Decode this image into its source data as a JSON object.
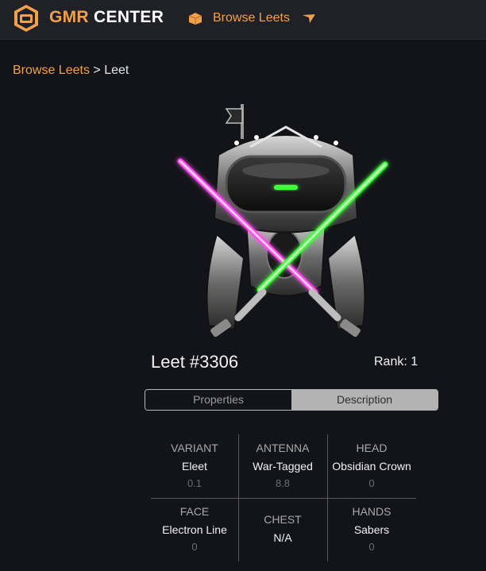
{
  "brand": {
    "name_part1": "GMR",
    "name_part2": "CENTER"
  },
  "nav": {
    "link_label": "Browse Leets"
  },
  "breadcrumb": {
    "link": "Browse Leets",
    "separator": ">",
    "current": "Leet"
  },
  "leet": {
    "title": "Leet #3306",
    "rank": "Rank: 1"
  },
  "tabs": [
    {
      "label": "Properties",
      "active": true
    },
    {
      "label": "Description",
      "active": false
    }
  ],
  "properties": [
    {
      "label": "VARIANT",
      "value": "Eleet",
      "score": "0.1"
    },
    {
      "label": "ANTENNA",
      "value": "War-Tagged",
      "score": "8.8"
    },
    {
      "label": "HEAD",
      "value": "Obsidian Crown",
      "score": "0"
    },
    {
      "label": "FACE",
      "value": "Electron Line",
      "score": "0"
    },
    {
      "label": "CHEST",
      "value": "N/A"
    },
    {
      "label": "HANDS",
      "value": "Sabers",
      "score": "0"
    }
  ],
  "colors": {
    "accent": "#f3a04b",
    "background": "#131419",
    "topbar": "#1f2127",
    "saber_left": "#ff4df0",
    "saber_right": "#43ff3a"
  },
  "icons": [
    "gmr-logo-icon",
    "box-icon",
    "chevron-down-icon"
  ]
}
